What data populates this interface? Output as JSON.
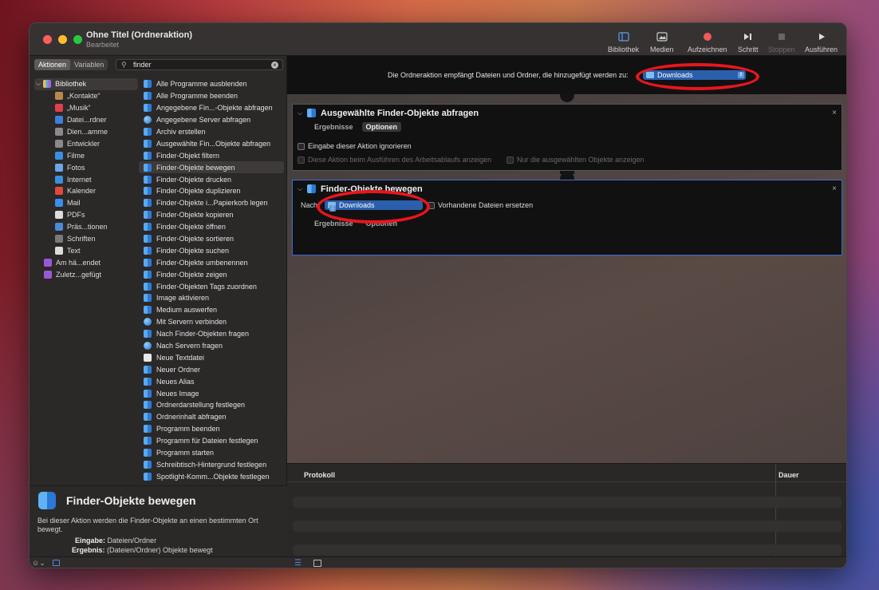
{
  "window": {
    "title": "Ohne Titel (Ordneraktion)",
    "subtitle": "Bearbeitet",
    "colors": {
      "close": "#ff5f57",
      "minimize": "#febc2e",
      "zoom": "#28c840",
      "accent": "#2b5fab",
      "highlight_ring": "#e8161e"
    }
  },
  "toolbar": {
    "library": "Bibliothek",
    "media": "Medien",
    "record": "Aufzeichnen",
    "step": "Schritt",
    "stop": "Stoppen",
    "run": "Ausführen"
  },
  "left": {
    "tabs": {
      "actions": "Aktionen",
      "variables": "Variablen"
    },
    "search": {
      "value": "finder",
      "icon": "search-icon"
    },
    "library_root": "Bibliothek",
    "library_items": [
      {
        "label": "„Kontakte“",
        "color": "#b88a4a"
      },
      {
        "label": "„Musik“",
        "color": "#e0404c"
      },
      {
        "label": "Datei...rdner",
        "color": "#3d7fd9"
      },
      {
        "label": "Dien...amme",
        "color": "#8a8a8a"
      },
      {
        "label": "Entwickler",
        "color": "#8a8a8a"
      },
      {
        "label": "Filme",
        "color": "#3a8fe0"
      },
      {
        "label": "Fotos",
        "color": "#6aa8e8"
      },
      {
        "label": "Internet",
        "color": "#3a90e0"
      },
      {
        "label": "Kalender",
        "color": "#e04a3a"
      },
      {
        "label": "Mail",
        "color": "#3a8fe8"
      },
      {
        "label": "PDFs",
        "color": "#dcdcdc"
      },
      {
        "label": "Präs...tionen",
        "color": "#4a8ad8"
      },
      {
        "label": "Schriften",
        "color": "#7a7a7a"
      },
      {
        "label": "Text",
        "color": "#dcdcdc"
      }
    ],
    "groups": [
      {
        "label": "Am hä...endet",
        "color": "#9a58d8"
      },
      {
        "label": "Zuletz...gefügt",
        "color": "#9a58d8"
      }
    ],
    "actions": [
      {
        "label": "Alle Programme ausblenden"
      },
      {
        "label": "Alle Programme beenden"
      },
      {
        "label": "Angegebene Fin...-Objekte abfragen"
      },
      {
        "label": "Angegebene Server abfragen",
        "net": true
      },
      {
        "label": "Archiv erstellen"
      },
      {
        "label": "Ausgewählte Fin...Objekte abfragen"
      },
      {
        "label": "Finder-Objekt filtern"
      },
      {
        "label": "Finder-Objekte bewegen",
        "selected": true
      },
      {
        "label": "Finder-Objekte drucken"
      },
      {
        "label": "Finder-Objekte duplizieren"
      },
      {
        "label": "Finder-Objekte i...Papierkorb legen"
      },
      {
        "label": "Finder-Objekte kopieren"
      },
      {
        "label": "Finder-Objekte öffnen"
      },
      {
        "label": "Finder-Objekte sortieren"
      },
      {
        "label": "Finder-Objekte suchen"
      },
      {
        "label": "Finder-Objekte umbenennen"
      },
      {
        "label": "Finder-Objekte zeigen"
      },
      {
        "label": "Finder-Objekten Tags zuordnen"
      },
      {
        "label": "Image aktivieren"
      },
      {
        "label": "Medium auswerfen"
      },
      {
        "label": "Mit Servern verbinden",
        "net": true
      },
      {
        "label": "Nach Finder-Objekten fragen"
      },
      {
        "label": "Nach Servern fragen",
        "net": true
      },
      {
        "label": "Neue Textdatei",
        "txt": true
      },
      {
        "label": "Neuer Ordner"
      },
      {
        "label": "Neues Alias"
      },
      {
        "label": "Neues Image"
      },
      {
        "label": "Ordnerdarstellung festlegen"
      },
      {
        "label": "Ordnerinhalt abfragen"
      },
      {
        "label": "Programm beenden"
      },
      {
        "label": "Programm für Dateien festlegen"
      },
      {
        "label": "Programm starten"
      },
      {
        "label": "Schreibtisch-Hintergrund festlegen"
      },
      {
        "label": "Spotlight-Komm...Objekte festlegen"
      }
    ],
    "description": {
      "title": "Finder-Objekte bewegen",
      "text": "Bei dieser Aktion werden die Finder-Objekte an einen bestimmten Ort bewegt.",
      "input_label": "Eingabe:",
      "input_value": "Dateien/Ordner",
      "result_label": "Ergebnis:",
      "result_value": "(Dateien/Ordner) Objekte bewegt"
    }
  },
  "workflow": {
    "header_label": "Die Ordneraktion empfängt Dateien und Ordner, die hinzugefügt werden zu:",
    "header_folder": "Downloads",
    "card1": {
      "title": "Ausgewählte Finder-Objekte abfragen",
      "tab_results": "Ergebnisse",
      "tab_options": "Optionen",
      "ignore_input": "Eingabe dieser Aktion ignorieren",
      "show_when_run": "Diese Aktion beim Ausführen des Arbeitsablaufs anzeigen",
      "show_selected_only": "Nur die ausgewählten Objekte anzeigen"
    },
    "card2": {
      "title": "Finder-Objekte bewegen",
      "to_label": "Nach:",
      "folder": "Downloads",
      "replace": "Vorhandene Dateien ersetzen",
      "tab_results": "Ergebnisse",
      "tab_options": "Optionen"
    }
  },
  "log": {
    "col_protocol": "Protokoll",
    "col_duration": "Dauer"
  }
}
